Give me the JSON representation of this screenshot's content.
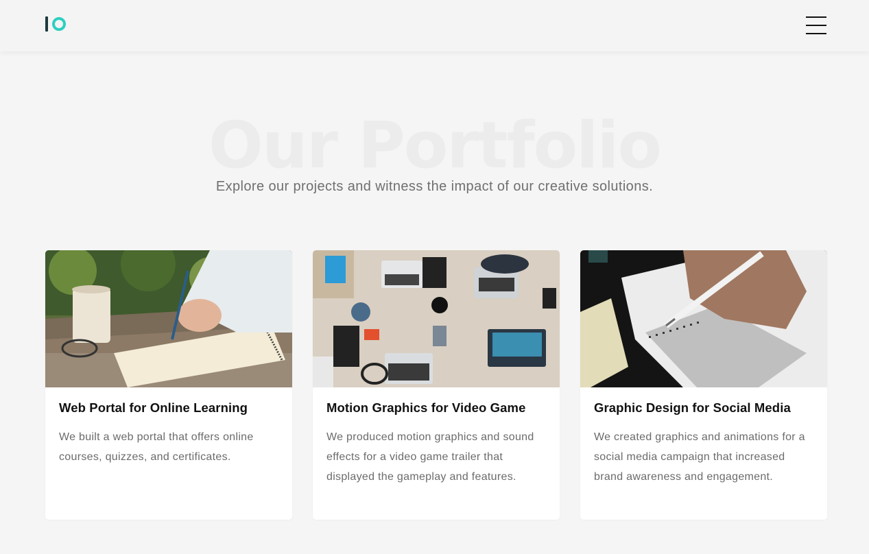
{
  "header": {
    "logo_label": "IO",
    "menu_icon": "hamburger-menu-icon"
  },
  "hero": {
    "title": "Our Portfolio",
    "subtitle": "Explore our projects and witness the impact of our creative solutions."
  },
  "colors": {
    "accent": "#2ccfc0",
    "logo_dark": "#1f3a42",
    "background": "#f5f5f5"
  },
  "projects": [
    {
      "title": "Web Portal for Online Learning",
      "description": "We built a web portal that offers online courses, quizzes, and certificates.",
      "image": "notebook-writing-photo"
    },
    {
      "title": "Motion Graphics for Video Game",
      "description": "We produced motion graphics and sound effects for a video game trailer that displayed the gameplay and features.",
      "image": "team-laptops-desk-photo"
    },
    {
      "title": "Graphic Design for Social Media",
      "description": "We created graphics and animations for a social media campaign that increased brand awareness and engagement.",
      "image": "answer-sheet-pencil-photo"
    }
  ]
}
